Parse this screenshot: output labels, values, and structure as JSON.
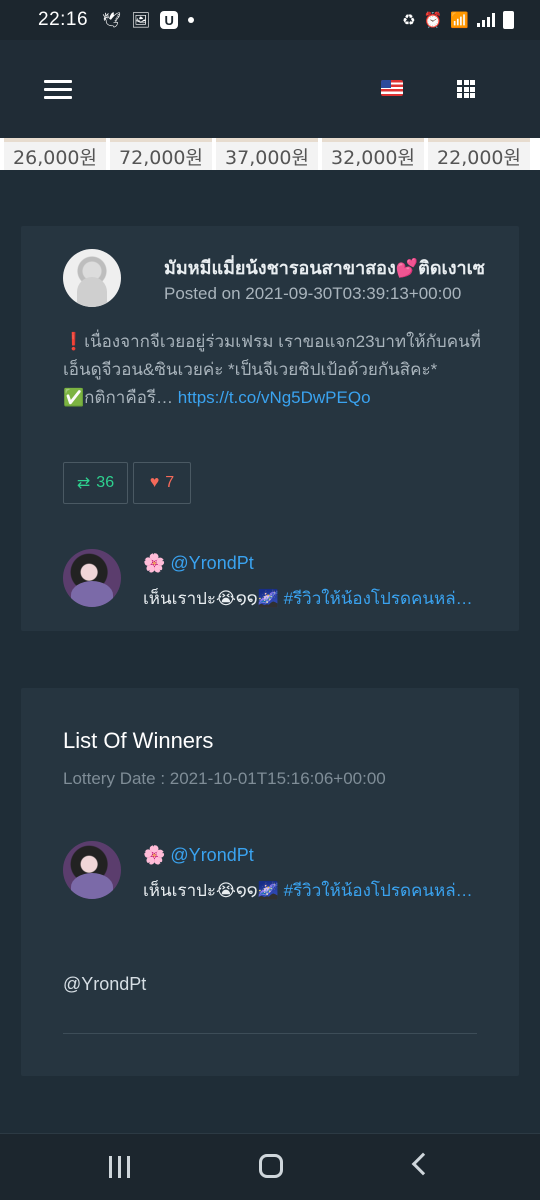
{
  "status_bar": {
    "time": "22:16",
    "left_icons": [
      "bird-icon",
      "image-icon",
      "u-app-icon",
      "dot-icon"
    ],
    "right_icons": [
      "battery-saver-icon",
      "alarm-icon",
      "wifi-icon",
      "signal-icon",
      "battery-icon"
    ],
    "u_letter": "U"
  },
  "navbar": {
    "icons": [
      "menu-icon",
      "us-flag-icon",
      "apps-grid-icon"
    ]
  },
  "price_strip": [
    "26,000원",
    "72,000원",
    "37,000원",
    "32,000원",
    "22,000원"
  ],
  "post": {
    "poster_name": "มัมหมีแมี่ยน้งชารอนสาขาสอง💕ติดเงาเซ",
    "posted_on": "Posted on 2021-09-30T03:39:13+00:00",
    "body_line1": "❗เนื่องจากจีเวยอยู่ร่วมเฟรม เราขอแจก23บาทให้กับคนที่เอ็นดูจีวอน&ซินเวยค่ะ *เป็นจีเวยชิปเป้อด้วยกันสิคะ*",
    "body_line2_prefix": "✅กติกาคือรี…",
    "body_link": "https://t.co/vNg5DwPEQo",
    "retweets": "36",
    "likes": "7"
  },
  "reply": {
    "handle": "🌸 @YrondPt",
    "text": "เห็นเราปะ😭໑໑🌌",
    "hashtag": "#รีวิวให้น้องโปรดคนหล่…"
  },
  "winners": {
    "title": "List Of Winners",
    "lottery_date": "Lottery Date : 2021-10-01T15:16:06+00:00",
    "entry": {
      "handle": "🌸 @YrondPt",
      "text": "เห็นเราปะ😭໑໑🌌",
      "hashtag": "#รีวิวให้น้องโปรดคนหล่…"
    },
    "winner_handle": "@YrondPt"
  },
  "system_nav": [
    "recent-apps-icon",
    "home-icon",
    "back-icon"
  ]
}
